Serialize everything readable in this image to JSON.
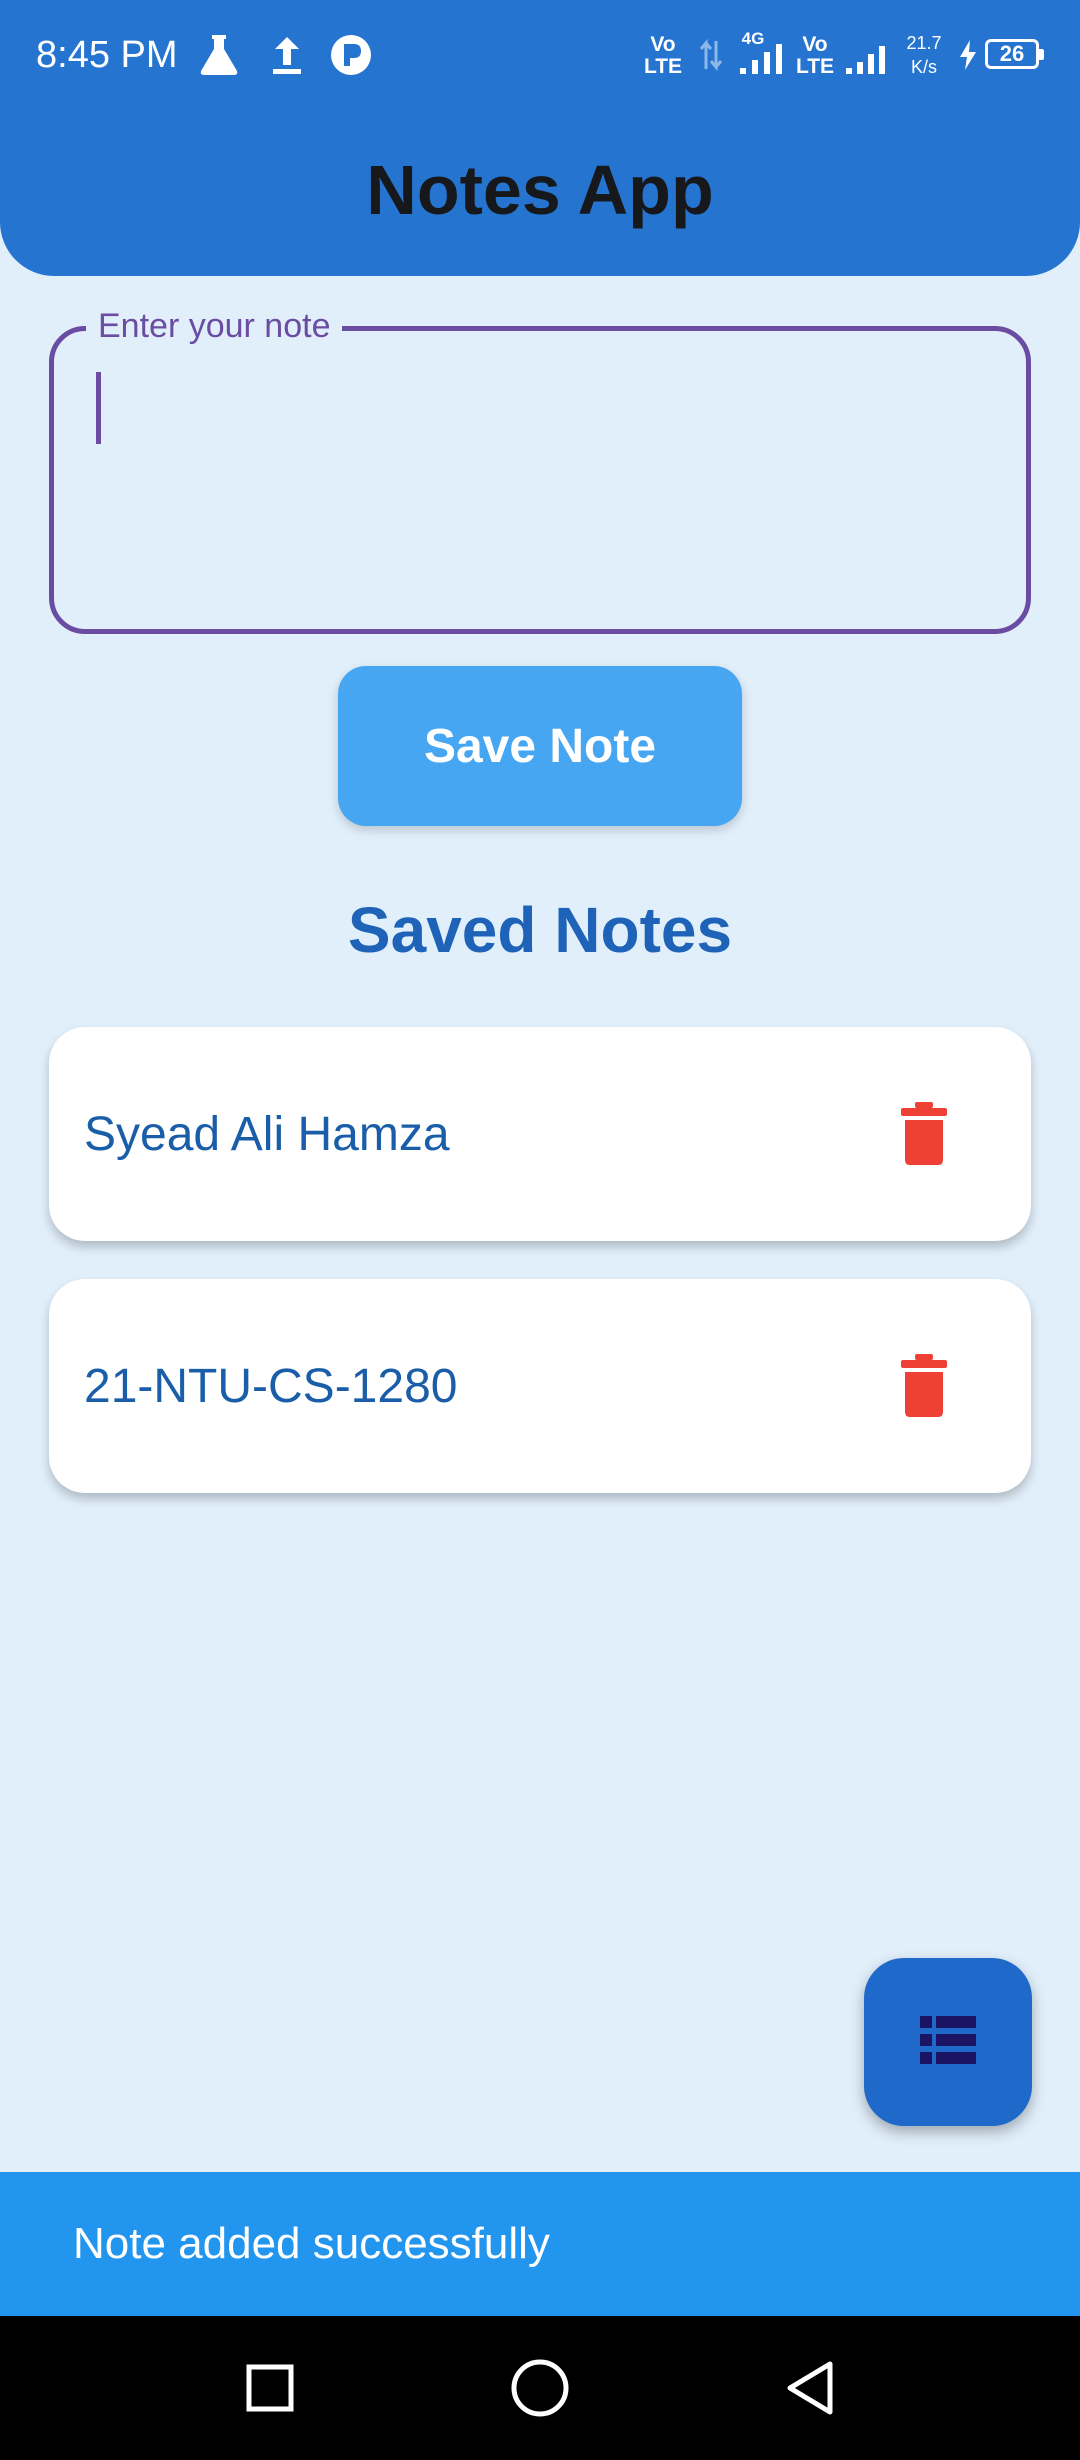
{
  "status_bar": {
    "time": "8:45 PM",
    "volte_1": [
      "Vo",
      "LTE"
    ],
    "network": "4G",
    "volte_2": [
      "Vo",
      "LTE"
    ],
    "speed": [
      "21.7",
      "K/s"
    ],
    "battery": "26"
  },
  "app_bar": {
    "title": "Notes App",
    "color": "#2574D0"
  },
  "note_input": {
    "label": "Enter your note",
    "value": "",
    "border_color": "#6A4DA3"
  },
  "save_button": {
    "label": "Save Note",
    "color": "#46A6F1"
  },
  "saved_notes": {
    "title": "Saved Notes",
    "items": [
      {
        "text": "Syead Ali Hamza",
        "action_icon": "trash-icon"
      },
      {
        "text": "21-NTU-CS-1280",
        "action_icon": "trash-icon"
      }
    ],
    "delete_color": "#EE4035"
  },
  "fab": {
    "icon": "list-icon",
    "color": "#1E69C9"
  },
  "snackbar": {
    "message": "Note added successfully",
    "color": "#2295EE"
  },
  "nav_bar": {
    "buttons": [
      "recents-icon",
      "home-icon",
      "back-icon"
    ]
  },
  "colors": {
    "background": "#E1EFFB",
    "title_text": "#16181C",
    "note_text": "#1A5DA8"
  }
}
